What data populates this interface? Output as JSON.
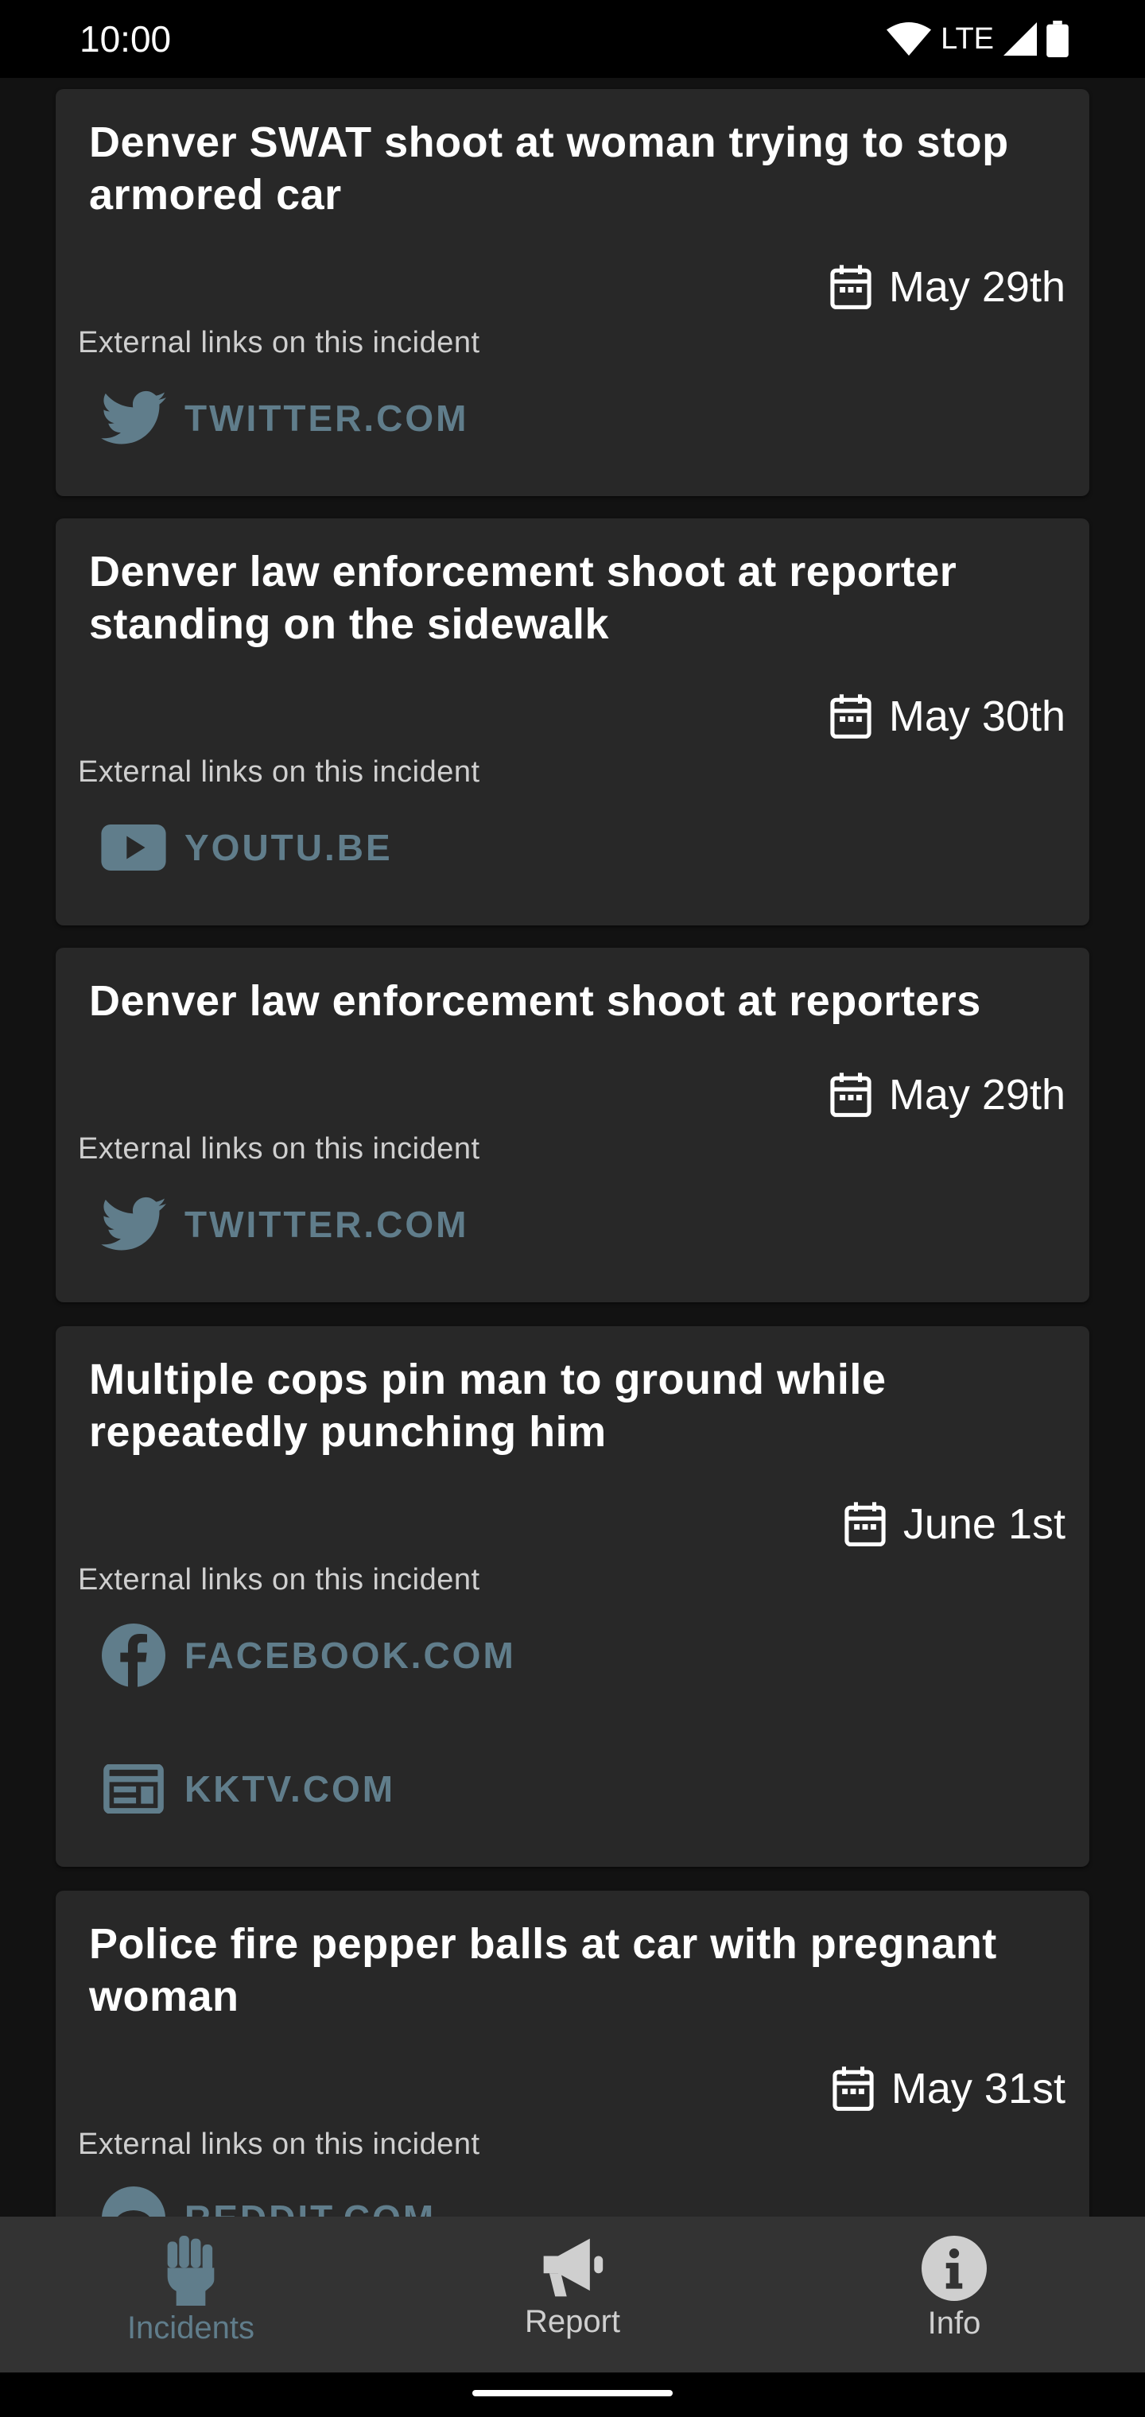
{
  "status_bar": {
    "time": "10:00",
    "network": "LTE"
  },
  "incidents": [
    {
      "title": "Denver SWAT shoot at woman trying to stop armored car",
      "date": "May 29th",
      "external_label": "External links on this incident",
      "links": [
        {
          "icon": "twitter-icon",
          "label": "TWITTER.COM"
        }
      ]
    },
    {
      "title": "Denver law enforcement shoot at reporter standing on the sidewalk",
      "date": "May 30th",
      "external_label": "External links on this incident",
      "links": [
        {
          "icon": "youtube-icon",
          "label": "YOUTU.BE"
        }
      ]
    },
    {
      "title": "Denver law enforcement shoot at reporters",
      "date": "May 29th",
      "external_label": "External links on this incident",
      "links": [
        {
          "icon": "twitter-icon",
          "label": "TWITTER.COM"
        }
      ]
    },
    {
      "title": "Multiple cops pin man to ground while repeatedly punching him",
      "date": "June 1st",
      "external_label": "External links on this incident",
      "links": [
        {
          "icon": "facebook-icon",
          "label": "FACEBOOK.COM"
        },
        {
          "icon": "news-icon",
          "label": "KKTV.COM"
        }
      ]
    },
    {
      "title": "Police fire pepper balls at car with pregnant woman",
      "date": "May 31st",
      "external_label": "External links on this incident",
      "links": [
        {
          "icon": "reddit-icon",
          "label": "REDDIT.COM"
        }
      ]
    }
  ],
  "bottom_nav": [
    {
      "label": "Incidents",
      "icon": "raised-fist-icon",
      "active": true
    },
    {
      "label": "Report",
      "icon": "megaphone-icon",
      "active": false
    },
    {
      "label": "Info",
      "icon": "info-icon",
      "active": false
    }
  ],
  "colors": {
    "background": "#121212",
    "card": "#282828",
    "accent": "#607d8b",
    "nav_bar": "#333333"
  }
}
